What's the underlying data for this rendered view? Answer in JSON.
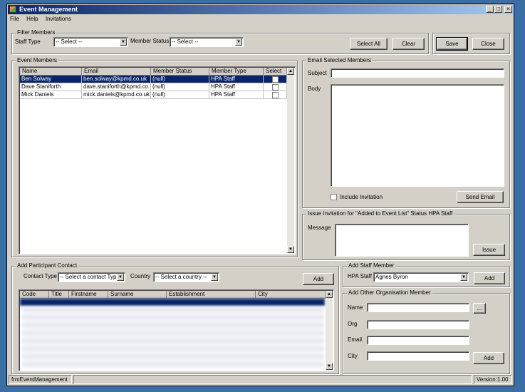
{
  "window": {
    "title": "Event Management"
  },
  "menu": [
    "File",
    "Help",
    "Invitations"
  ],
  "filter": {
    "group_label": "Filter Members",
    "staff_type_label": "Staff Type",
    "staff_type_value": "-- Select --",
    "member_status_label": "Member Status",
    "member_status_value": "-- Select --",
    "select_all": "Select All",
    "clear": "Clear"
  },
  "actions": {
    "save": "Save",
    "close": "Close"
  },
  "members": {
    "group_label": "Event Members",
    "columns": [
      "Name",
      "Email",
      "Member Status",
      "Member Type",
      "Select"
    ],
    "rows": [
      {
        "name": "Ben Solway",
        "email": "ben.solway@kpmd.co.uk",
        "status": "(null)",
        "type": "HPA Staff"
      },
      {
        "name": "Dave Staniforth",
        "email": "dave.staniforth@kpmd.co.",
        "status": "(null)",
        "type": "HPA Staff"
      },
      {
        "name": "Mick Daniels",
        "email": "mick.daniels@kpmd.co.uk",
        "status": "(null)",
        "type": "HPA Staff"
      }
    ]
  },
  "email": {
    "group_label": "Email Selected Members",
    "subject_label": "Subject",
    "body_label": "Body",
    "include_invitation": "Include Invitation",
    "send": "Send Email"
  },
  "invitation": {
    "group_label": "Issue Invitation for \"Added to Event List\" Status HPA Staff",
    "message_label": "Message",
    "issue": "Issue"
  },
  "participant": {
    "group_label": "Add Participant Contact",
    "contact_type_label": "Contact Type",
    "contact_type_value": "-- Select a contact Type",
    "country_label": "Country",
    "country_value": "-- Select a country --",
    "add": "Add",
    "columns": [
      "Code",
      "Title",
      "Firstname",
      "Surname",
      "Establishment",
      "City"
    ]
  },
  "staff": {
    "group_label": "Add Staff Member",
    "hpa_staff_label": "HPA Staff",
    "hpa_staff_value": "Agnes Byron",
    "add": "Add"
  },
  "other_org": {
    "group_label": "Add Other Organisation Member",
    "name_label": "Name",
    "org_label": "Org",
    "email_label": "Email",
    "city_label": "City",
    "browse": "...",
    "add": "Add"
  },
  "statusbar": {
    "form_name": "frmEventManagement",
    "version": "Version:1.00"
  }
}
